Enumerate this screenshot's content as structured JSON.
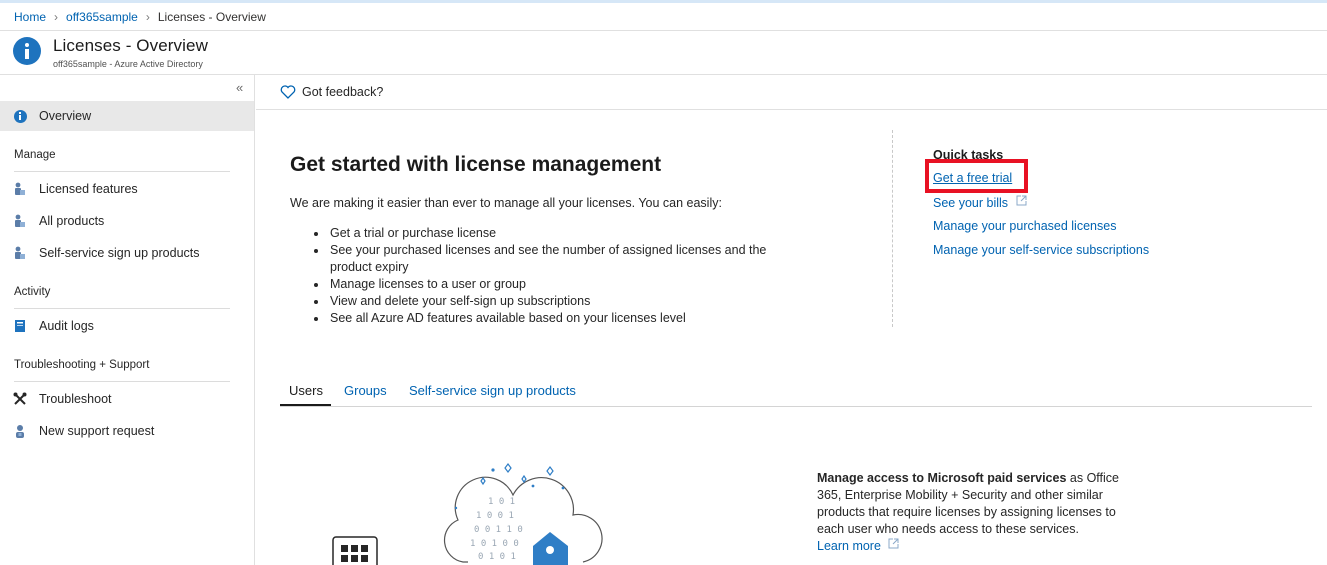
{
  "breadcrumb": {
    "home": "Home",
    "tenant": "off365sample",
    "current": "Licenses - Overview"
  },
  "header": {
    "title": "Licenses - Overview",
    "subtitle": "off365sample - Azure Active Directory",
    "icon": "info-icon"
  },
  "sidebar": {
    "collapse_label": "«",
    "overview": "Overview",
    "sections": {
      "manage": {
        "heading": "Manage",
        "items": [
          "Licensed features",
          "All products",
          "Self-service sign up products"
        ]
      },
      "activity": {
        "heading": "Activity",
        "items": [
          "Audit logs"
        ]
      },
      "support": {
        "heading": "Troubleshooting + Support",
        "items": [
          "Troubleshoot",
          "New support request"
        ]
      }
    }
  },
  "toolbar": {
    "feedback": "Got feedback?"
  },
  "get_started": {
    "title": "Get started with license management",
    "intro": "We are making it easier than ever to manage all your licenses. You can easily:",
    "bullets": [
      "Get a trial or purchase license",
      "See your purchased licenses and see the number of assigned licenses and the product expiry",
      "Manage licenses to a user or group",
      "View and delete your self-sign up subscriptions",
      "See all Azure AD features available based on your licenses level"
    ]
  },
  "quick_tasks": {
    "title": "Quick tasks",
    "links": [
      "Get a free trial",
      "See your bills",
      "Manage your purchased licenses",
      "Manage your self-service subscriptions"
    ]
  },
  "tabs": [
    "Users",
    "Groups",
    "Self-service sign up products"
  ],
  "users_panel": {
    "bold": "Manage access to Microsoft paid services",
    "text": " as Office 365, Enterprise Mobility + Security and other similar products that require licenses by assigning licenses to each user who needs access to these services.",
    "learn_more": "Learn more"
  },
  "colors": {
    "accent": "#0063b1",
    "highlight": "#e81123",
    "icon_blue": "#1e73be"
  }
}
